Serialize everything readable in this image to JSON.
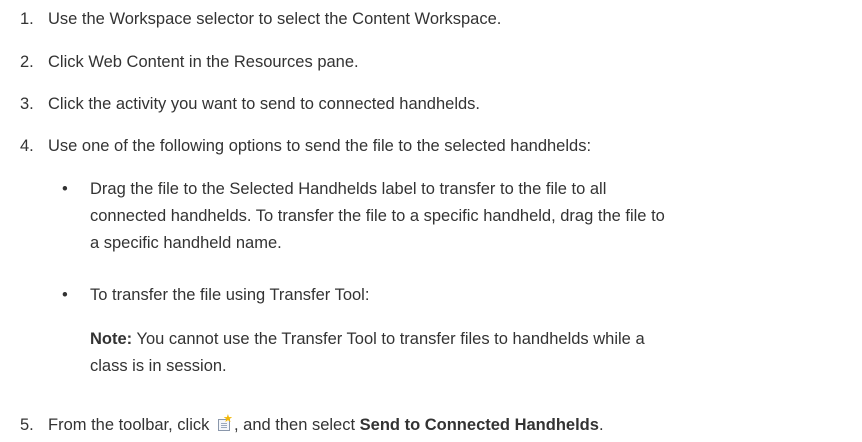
{
  "steps": [
    {
      "num": "1.",
      "text": "Use the Workspace selector to select the Content Workspace."
    },
    {
      "num": "2.",
      "text": "Click Web Content in the Resources pane."
    },
    {
      "num": "3.",
      "text": "Click the activity you want to send to connected handhelds."
    },
    {
      "num": "4.",
      "text": "Use one of the following options to send the file to the selected handhelds:"
    }
  ],
  "bullets": [
    {
      "dot": "•",
      "lines": [
        "Drag the file to the Selected Handhelds label to transfer to the file to all",
        "connected handhelds. To transfer the file to a specific handheld, drag the file to",
        "a specific handheld name."
      ]
    },
    {
      "dot": "•",
      "lines": [
        "To transfer the file using Transfer Tool:"
      ]
    }
  ],
  "note": {
    "label": "Note:",
    "line1": " You cannot use the Transfer Tool to transfer files to handhelds while a",
    "line2": "class is in session."
  },
  "step5": {
    "num": "5.",
    "before": "From the toolbar, click ",
    "icon": "new-document-icon",
    "after": ", and then select ",
    "bold": "Send to Connected Handhelds",
    "end": "."
  }
}
